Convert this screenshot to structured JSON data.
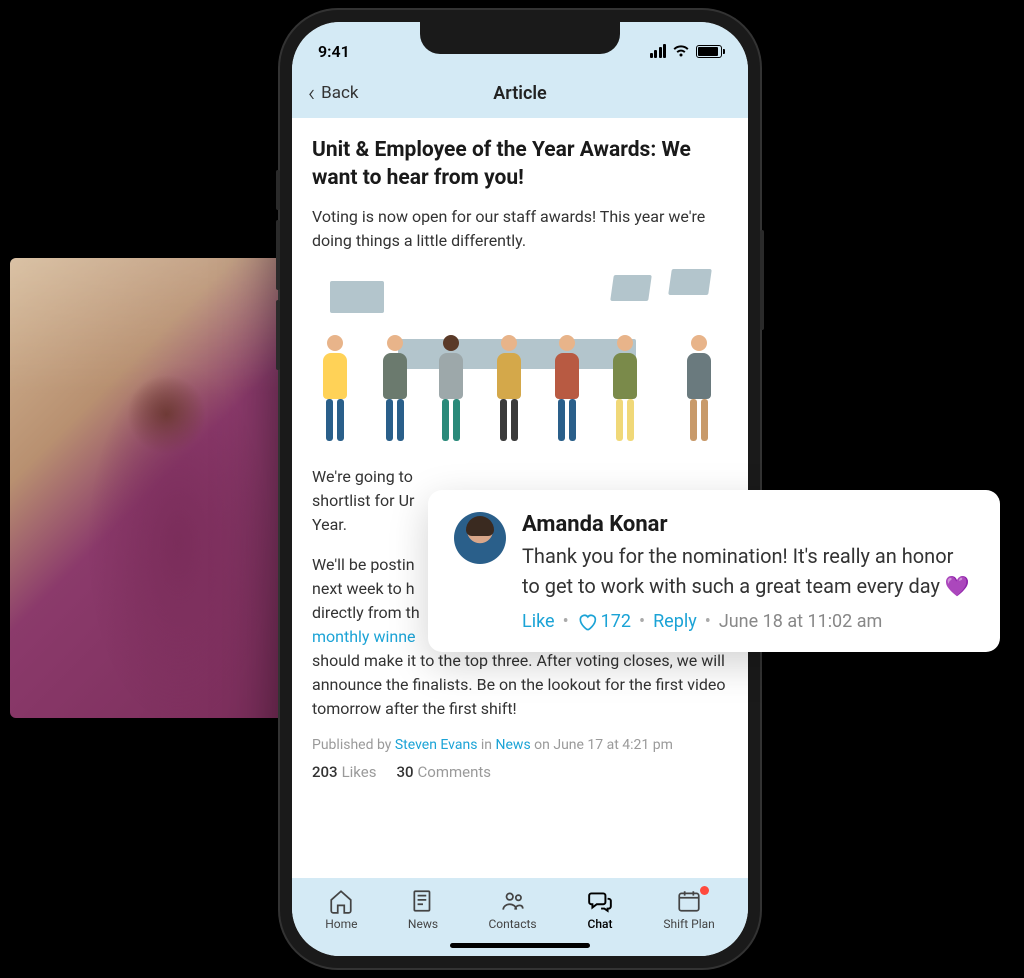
{
  "statusBar": {
    "time": "9:41"
  },
  "nav": {
    "back": "Back",
    "title": "Article"
  },
  "article": {
    "headline": "Unit & Employee of the Year Awards: We want to hear from you!",
    "intro": "Voting is now open for our staff awards! This year we're doing things a little differently.",
    "para1a": "We're going to ",
    "para1_truncated_visible": "shortlist for Ur",
    "para1c": "Year.",
    "para2a": "We'll be postin",
    "para2b": "next week to h",
    "para2c": "directly from th",
    "para2_link": "monthly winne",
    "para2d": "should make it to the top three. After voting closes, we will announce the finalists. Be on the lookout for the first video tomorrow after the first shift!",
    "pub_prefix": "Published by ",
    "pub_author": "Steven Evans",
    "pub_in": " in ",
    "pub_channel": "News",
    "pub_on": " on June 17 at 4:21 pm",
    "likes_count": "203",
    "likes_label": "Likes",
    "comments_count": "30",
    "comments_label": "Comments"
  },
  "tabs": {
    "home": "Home",
    "news": "News",
    "contacts": "Contacts",
    "chat": "Chat",
    "shiftplan": "Shift Plan"
  },
  "comment": {
    "author": "Amanda Konar",
    "text": "Thank you for the nomination! It's really an honor to get to work with such a great team every day 💜",
    "like_label": "Like",
    "like_count": "172",
    "reply_label": "Reply",
    "timestamp": "June 18 at 11:02 am"
  }
}
